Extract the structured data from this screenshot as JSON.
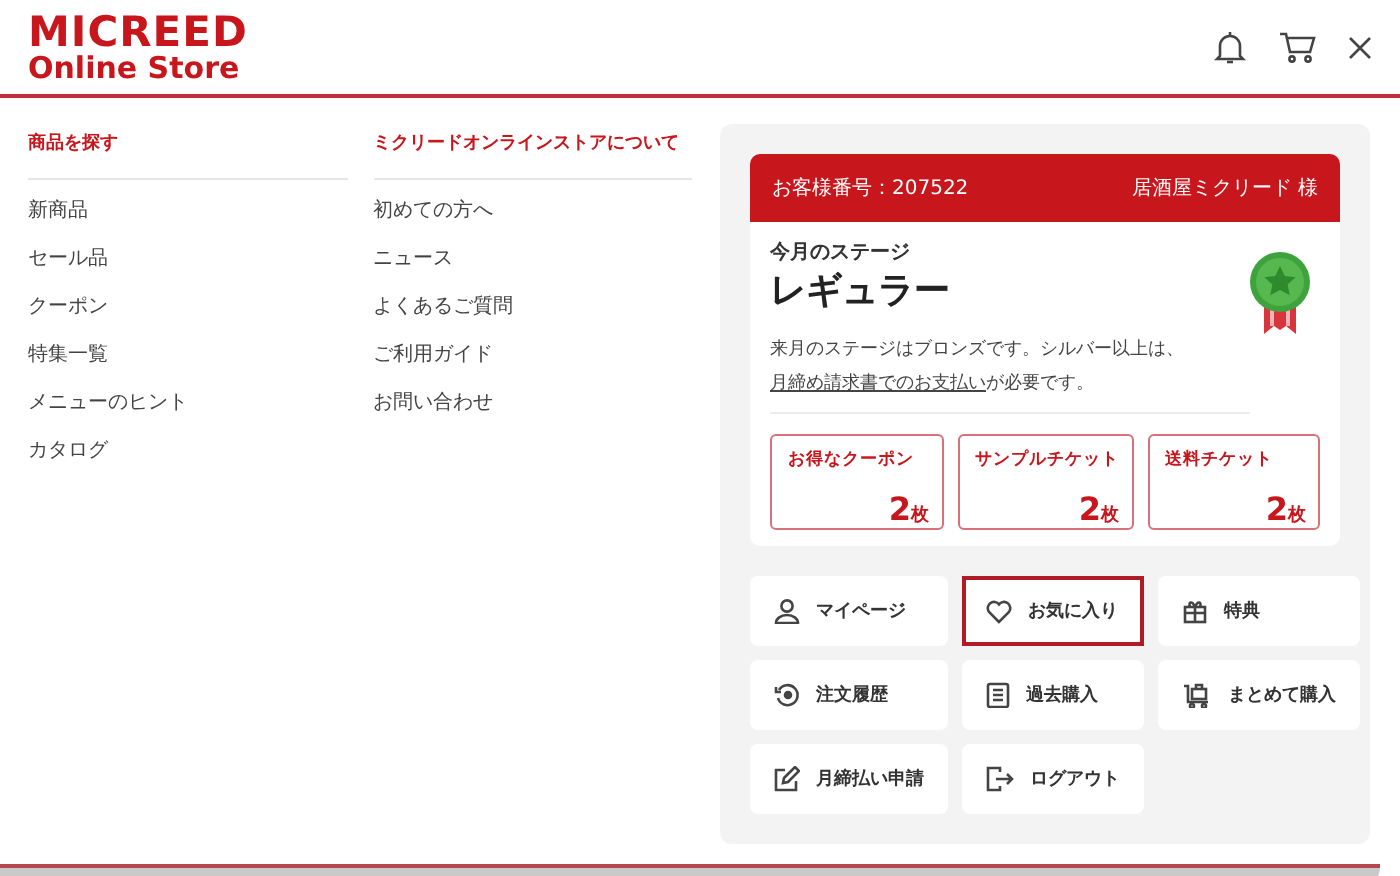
{
  "header": {
    "logo_line_1": "MICREED",
    "logo_line_2": "Online Store"
  },
  "nav_columns": [
    {
      "heading": "商品を探す",
      "items": [
        "新商品",
        "セール品",
        "クーポン",
        "特集一覧",
        "メニューのヒント",
        "カタログ"
      ]
    },
    {
      "heading": "ミクリードオンラインストアについて",
      "items": [
        "初めての方へ",
        "ニュース",
        "よくあるご質問",
        "ご利用ガイド",
        "お問い合わせ"
      ]
    }
  ],
  "member": {
    "customer_number": "お客様番号：207522",
    "customer_name": "居酒屋ミクリード 様",
    "stage_label": "今月のステージ",
    "stage": "レギュラー",
    "note_before": "来月のステージはブロンズです。シルバー以上は、",
    "note_link": "月締め請求書でのお支払い",
    "note_after": "が必要です。",
    "tickets": [
      {
        "label": "お得なクーポン",
        "count": "2",
        "unit": "枚"
      },
      {
        "label": "サンプルチケット",
        "count": "2",
        "unit": "枚"
      },
      {
        "label": "送料チケット",
        "count": "2",
        "unit": "枚"
      }
    ]
  },
  "menu_tiles": [
    {
      "label": "マイページ",
      "highlighted": false
    },
    {
      "label": "お気に入り",
      "highlighted": true
    },
    {
      "label": "特典",
      "highlighted": false
    },
    {
      "label": "注文履歴",
      "highlighted": false
    },
    {
      "label": "過去購入",
      "highlighted": false
    },
    {
      "label": "まとめて購入",
      "highlighted": false
    },
    {
      "label": "月締払い申請",
      "highlighted": false
    },
    {
      "label": "ログアウト",
      "highlighted": false
    }
  ]
}
